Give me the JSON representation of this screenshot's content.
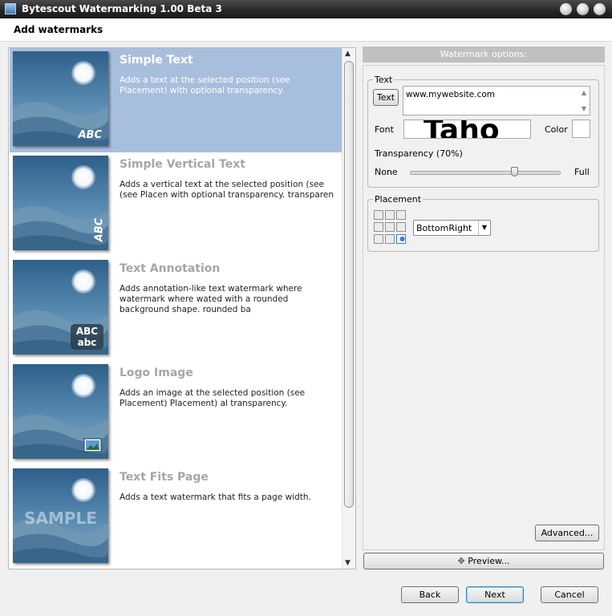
{
  "window": {
    "title": "Bytescout Watermarking 1.00 Beta 3"
  },
  "header": {
    "title": "Add watermarks"
  },
  "list": {
    "items": [
      {
        "title": "Simple Text",
        "desc": "Adds a text at the selected position (see Placement) with optional transparency.",
        "thumb_label": "ABC",
        "selected": true
      },
      {
        "title": "Simple Vertical Text",
        "desc": "Adds a vertical text at the selected position (see (see Placen with optional transparency. transparen",
        "thumb_label": "ABC",
        "selected": false
      },
      {
        "title": "Text Annotation",
        "desc": "Adds annotation-like text watermark where watermark where wated with a rounded background shape. rounded ba",
        "thumb_label": "ABC",
        "thumb_label2": "abc",
        "selected": false
      },
      {
        "title": "Logo Image",
        "desc": "Adds an image at the selected position (see Placement) Placement) al transparency.",
        "selected": false
      },
      {
        "title": "Text Fits Page",
        "desc": "Adds a text watermark that fits a page width.",
        "thumb_label": "SAMPLE",
        "selected": false
      }
    ]
  },
  "options": {
    "header": "Watermark options:",
    "text_group": {
      "legend": "Text",
      "text_button": "Text",
      "text_value": "www.mywebsite.com",
      "font_label": "Font",
      "font_preview": "Tahо",
      "color_label": "Color",
      "transparency_label": "Transparency (70%)",
      "transparency_value": 0.7,
      "none_label": "None",
      "full_label": "Full"
    },
    "placement_group": {
      "legend": "Placement",
      "selected": "BottomRight"
    },
    "advanced_button": "Advanced...",
    "preview_button": "Preview..."
  },
  "footer": {
    "back": "Back",
    "next": "Next",
    "cancel": "Cancel"
  },
  "colors": {
    "selection": "#a8bedd",
    "title_bar": "#262626",
    "thumb_sky": "#3a6f9a"
  }
}
